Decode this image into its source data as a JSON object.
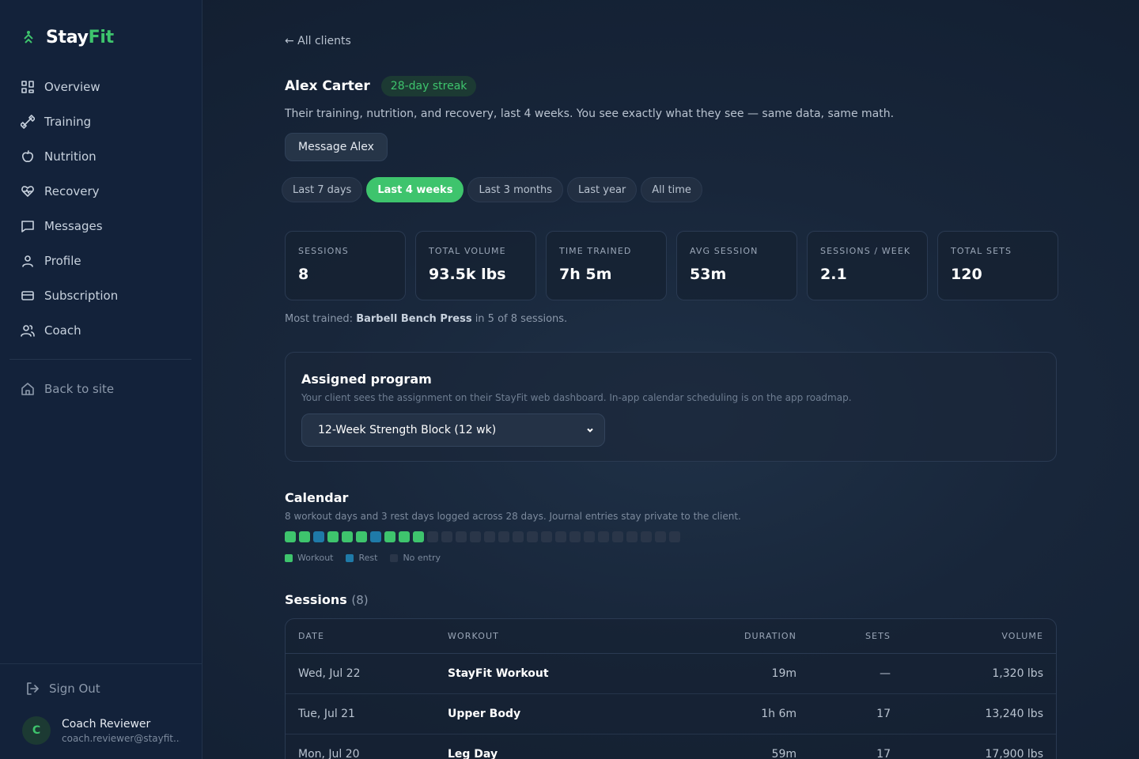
{
  "brand": {
    "name_a": "Stay",
    "name_b": "Fit",
    "icon": "runner-icon",
    "accent": "#3ec46d"
  },
  "sidebar": {
    "items": [
      {
        "label": "Overview",
        "icon": "grid-icon"
      },
      {
        "label": "Training",
        "icon": "dumbbell-icon"
      },
      {
        "label": "Nutrition",
        "icon": "apple-icon"
      },
      {
        "label": "Recovery",
        "icon": "heart-pulse-icon"
      },
      {
        "label": "Messages",
        "icon": "message-icon"
      },
      {
        "label": "Profile",
        "icon": "user-icon"
      },
      {
        "label": "Subscription",
        "icon": "card-icon"
      },
      {
        "label": "Coach",
        "icon": "users-icon"
      }
    ],
    "back_to_site": "Back to site",
    "sign_out": "Sign Out",
    "user": {
      "initial": "C",
      "name": "Coach Reviewer",
      "email": "coach.reviewer@stayfit...."
    }
  },
  "header": {
    "back_link": "← All clients",
    "client_name": "Alex Carter",
    "streak": "28-day streak",
    "description": "Their training, nutrition, and recovery, last 4 weeks. You see exactly what they see — same data, same math.",
    "message_button": "Message Alex"
  },
  "ranges": [
    {
      "label": "Last 7 days",
      "active": false
    },
    {
      "label": "Last 4 weeks",
      "active": true
    },
    {
      "label": "Last 3 months",
      "active": false
    },
    {
      "label": "Last year",
      "active": false
    },
    {
      "label": "All time",
      "active": false
    }
  ],
  "stats": [
    {
      "label": "SESSIONS",
      "value": "8"
    },
    {
      "label": "TOTAL VOLUME",
      "value": "93.5k lbs"
    },
    {
      "label": "TIME TRAINED",
      "value": "7h 5m"
    },
    {
      "label": "AVG SESSION",
      "value": "53m"
    },
    {
      "label": "SESSIONS / WEEK",
      "value": "2.1"
    },
    {
      "label": "TOTAL SETS",
      "value": "120"
    }
  ],
  "most_trained": {
    "prefix": "Most trained: ",
    "exercise": "Barbell Bench Press",
    "suffix": " in 5 of 8 sessions."
  },
  "program": {
    "title": "Assigned program",
    "subtitle": "Your client sees the assignment on their StayFit web dashboard. In-app calendar scheduling is on the app roadmap.",
    "selected": "12-Week Strength Block (12 wk)"
  },
  "calendar": {
    "title": "Calendar",
    "subtitle": "8 workout days and 3 rest days logged across 28 days. Journal entries stay private to the client.",
    "days": [
      "workout",
      "workout",
      "rest",
      "workout",
      "workout",
      "workout",
      "rest",
      "workout",
      "workout",
      "workout",
      "none",
      "none",
      "none",
      "none",
      "none",
      "none",
      "none",
      "none",
      "none",
      "none",
      "none",
      "none",
      "none",
      "none",
      "none",
      "none",
      "none",
      "none"
    ],
    "colors": {
      "workout": "#3ec46d",
      "rest": "#1f7aa8",
      "none": "#2a3649"
    },
    "legend": {
      "workout": "Workout",
      "rest": "Rest",
      "none": "No entry"
    }
  },
  "sessions": {
    "title": "Sessions",
    "count": "(8)",
    "columns": {
      "date": "DATE",
      "workout": "WORKOUT",
      "duration": "DURATION",
      "sets": "SETS",
      "volume": "VOLUME"
    },
    "rows": [
      {
        "date": "Wed, Jul 22",
        "workout": "StayFit Workout",
        "duration": "19m",
        "sets": "—",
        "volume": "1,320 lbs"
      },
      {
        "date": "Tue, Jul 21",
        "workout": "Upper Body",
        "duration": "1h 6m",
        "sets": "17",
        "volume": "13,240 lbs"
      },
      {
        "date": "Mon, Jul 20",
        "workout": "Leg Day",
        "duration": "59m",
        "sets": "17",
        "volume": "17,900 lbs"
      }
    ]
  }
}
